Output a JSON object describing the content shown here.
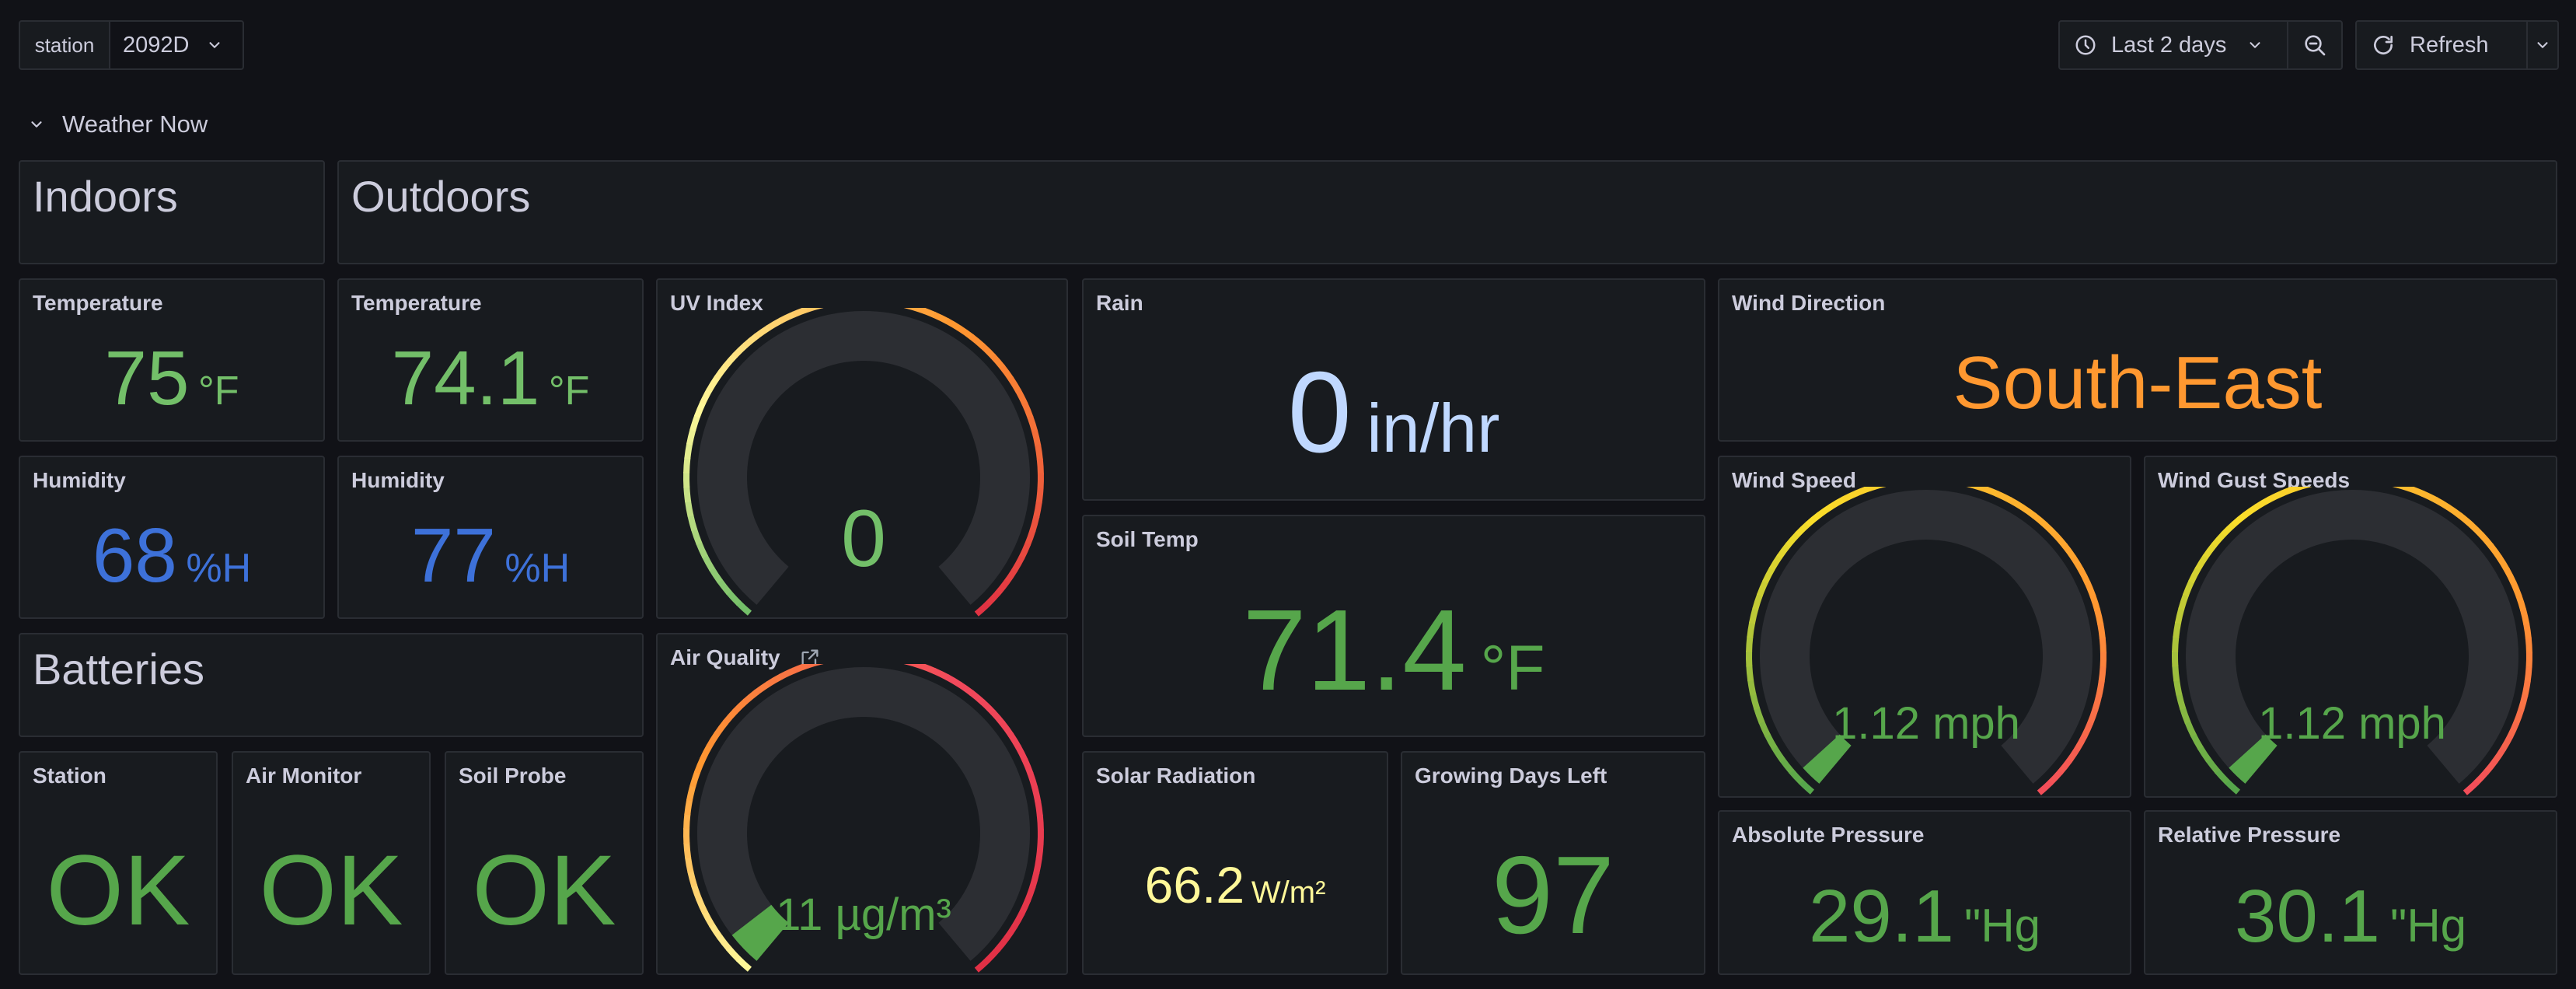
{
  "toolbar": {
    "variable_label": "station",
    "variable_value": "2092D",
    "time_range": "Last 2 days",
    "refresh_label": "Refresh"
  },
  "row": {
    "title": "Weather Now"
  },
  "sections": {
    "indoors": "Indoors",
    "outdoors": "Outdoors",
    "batteries": "Batteries"
  },
  "panels": {
    "indoor_temp": {
      "title": "Temperature",
      "value": "75",
      "unit": "°F"
    },
    "indoor_humidity": {
      "title": "Humidity",
      "value": "68",
      "unit": "%H"
    },
    "outdoor_temp": {
      "title": "Temperature",
      "value": "74.1",
      "unit": "°F"
    },
    "outdoor_humidity": {
      "title": "Humidity",
      "value": "77",
      "unit": "%H"
    },
    "uv_index": {
      "title": "UV Index",
      "value": "0",
      "min": 0,
      "max": 11,
      "level": 0
    },
    "air_quality": {
      "title": "Air Quality",
      "value": "11 µg/m³",
      "min": 0,
      "max": 250,
      "level": 11
    },
    "rain": {
      "title": "Rain",
      "value": "0",
      "unit": "in/hr"
    },
    "soil_temp": {
      "title": "Soil Temp",
      "value": "71.4",
      "unit": "°F"
    },
    "solar_radiation": {
      "title": "Solar Radiation",
      "value": "66.2",
      "unit": "W/m²"
    },
    "growing_days": {
      "title": "Growing Days Left",
      "value": "97"
    },
    "wind_direction": {
      "title": "Wind Direction",
      "value": "South-East"
    },
    "wind_speed": {
      "title": "Wind Speed",
      "value": "1.12 mph",
      "min": 0,
      "max": 40,
      "level": 1.12
    },
    "wind_gust": {
      "title": "Wind Gust Speeds",
      "value": "1.12 mph",
      "min": 0,
      "max": 40,
      "level": 1.12
    },
    "absolute_pressure": {
      "title": "Absolute Pressure",
      "value": "29.1",
      "unit": "\"Hg"
    },
    "relative_pressure": {
      "title": "Relative Pressure",
      "value": "30.1",
      "unit": "\"Hg"
    },
    "battery_station": {
      "title": "Station",
      "value": "OK"
    },
    "battery_air": {
      "title": "Air Monitor",
      "value": "OK"
    },
    "battery_soil": {
      "title": "Soil Probe",
      "value": "OK"
    }
  },
  "colors": {
    "green": "#73bf69",
    "dark_green": "#56a64b",
    "blue": "#5794f2",
    "light_blue": "#c0d8ff",
    "orange": "#ff9830",
    "yellow": "#fff899",
    "red": "#e02f44",
    "gauge_track": "#2c2e33"
  }
}
